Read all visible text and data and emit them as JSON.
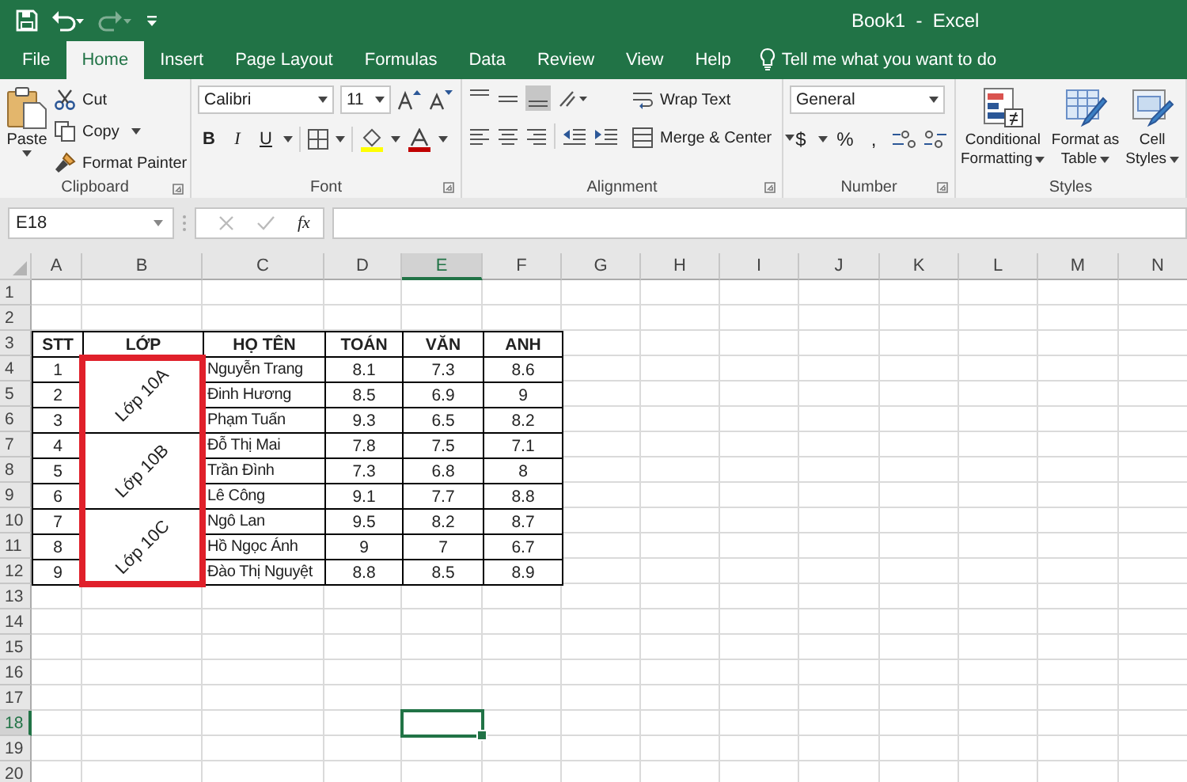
{
  "title_bar": {
    "title": "Book1  -  Excel"
  },
  "tabs": [
    {
      "label": "File",
      "selected": false
    },
    {
      "label": "Home",
      "selected": true
    },
    {
      "label": "Insert",
      "selected": false
    },
    {
      "label": "Page Layout",
      "selected": false
    },
    {
      "label": "Formulas",
      "selected": false
    },
    {
      "label": "Data",
      "selected": false
    },
    {
      "label": "Review",
      "selected": false
    },
    {
      "label": "View",
      "selected": false
    },
    {
      "label": "Help",
      "selected": false
    }
  ],
  "tell_me": "Tell me what you want to do",
  "ribbon": {
    "clipboard": {
      "paste": "Paste",
      "cut": "Cut",
      "copy": "Copy",
      "format_painter": "Format Painter",
      "label": "Clipboard"
    },
    "font": {
      "name": "Calibri",
      "size": "11",
      "bold": "B",
      "italic": "I",
      "underline": "U",
      "label": "Font"
    },
    "alignment": {
      "wrap_text": "Wrap Text",
      "merge_center": "Merge & Center",
      "label": "Alignment"
    },
    "number": {
      "format": "General",
      "currency": "$",
      "percent": "%",
      "comma": ",",
      "label": "Number"
    },
    "styles": {
      "buttons": [
        {
          "kind": "conditional",
          "line1": "Conditional",
          "line2": "Formatting"
        },
        {
          "kind": "table",
          "line1": "Format as",
          "line2": "Table"
        },
        {
          "kind": "cell",
          "line1": "Cell",
          "line2": "Styles"
        }
      ],
      "label": "Styles"
    }
  },
  "formula_bar": {
    "name_box": "E18",
    "fx": "fx"
  },
  "columns": [
    {
      "label": "A",
      "selected": false
    },
    {
      "label": "B",
      "selected": false
    },
    {
      "label": "C",
      "selected": false
    },
    {
      "label": "D",
      "selected": false
    },
    {
      "label": "E",
      "selected": true
    },
    {
      "label": "F",
      "selected": false
    },
    {
      "label": "G",
      "selected": false
    },
    {
      "label": "H",
      "selected": false
    },
    {
      "label": "I",
      "selected": false
    },
    {
      "label": "J",
      "selected": false
    },
    {
      "label": "K",
      "selected": false
    },
    {
      "label": "L",
      "selected": false
    },
    {
      "label": "M",
      "selected": false
    },
    {
      "label": "N",
      "selected": false
    }
  ],
  "rows": [
    {
      "label": "1",
      "selected": false
    },
    {
      "label": "2",
      "selected": false
    },
    {
      "label": "3",
      "selected": false
    },
    {
      "label": "4",
      "selected": false
    },
    {
      "label": "5",
      "selected": false
    },
    {
      "label": "6",
      "selected": false
    },
    {
      "label": "7",
      "selected": false
    },
    {
      "label": "8",
      "selected": false
    },
    {
      "label": "9",
      "selected": false
    },
    {
      "label": "10",
      "selected": false
    },
    {
      "label": "11",
      "selected": false
    },
    {
      "label": "12",
      "selected": false
    },
    {
      "label": "13",
      "selected": false
    },
    {
      "label": "14",
      "selected": false
    },
    {
      "label": "15",
      "selected": false
    },
    {
      "label": "16",
      "selected": false
    },
    {
      "label": "17",
      "selected": false
    },
    {
      "label": "18",
      "selected": true
    },
    {
      "label": "19",
      "selected": false
    },
    {
      "label": "20",
      "selected": false
    }
  ],
  "table": {
    "outlined": true,
    "headers": [
      "STT",
      "LỚP",
      "HỌ TÊN",
      "TOÁN",
      "VĂN",
      "ANH"
    ],
    "groups": [
      {
        "label": "Lớp 10A",
        "students": [
          {
            "stt": "1",
            "name": "Nguyễn Trang",
            "toan": "8.1",
            "van": "7.3",
            "anh": "8.6"
          },
          {
            "stt": "2",
            "name": "Đinh Hương",
            "toan": "8.5",
            "van": "6.9",
            "anh": "9"
          },
          {
            "stt": "3",
            "name": "Phạm Tuấn",
            "toan": "9.3",
            "van": "6.5",
            "anh": "8.2"
          }
        ]
      },
      {
        "label": "Lớp 10B",
        "students": [
          {
            "stt": "4",
            "name": "Đỗ Thị Mai",
            "toan": "7.8",
            "van": "7.5",
            "anh": "7.1"
          },
          {
            "stt": "5",
            "name": "Trần Đình",
            "toan": "7.3",
            "van": "6.8",
            "anh": "8"
          },
          {
            "stt": "6",
            "name": "Lê Công",
            "toan": "9.1",
            "van": "7.7",
            "anh": "8.8"
          }
        ]
      },
      {
        "label": "Lớp 10C",
        "students": [
          {
            "stt": "7",
            "name": "Ngô Lan",
            "toan": "9.5",
            "van": "8.2",
            "anh": "8.7"
          },
          {
            "stt": "8",
            "name": "Hồ Ngọc Ánh",
            "toan": "9",
            "van": "7",
            "anh": "6.7"
          },
          {
            "stt": "9",
            "name": "Đào Thị Nguyệt",
            "toan": "8.8",
            "van": "8.5",
            "anh": "8.9"
          }
        ]
      }
    ]
  }
}
